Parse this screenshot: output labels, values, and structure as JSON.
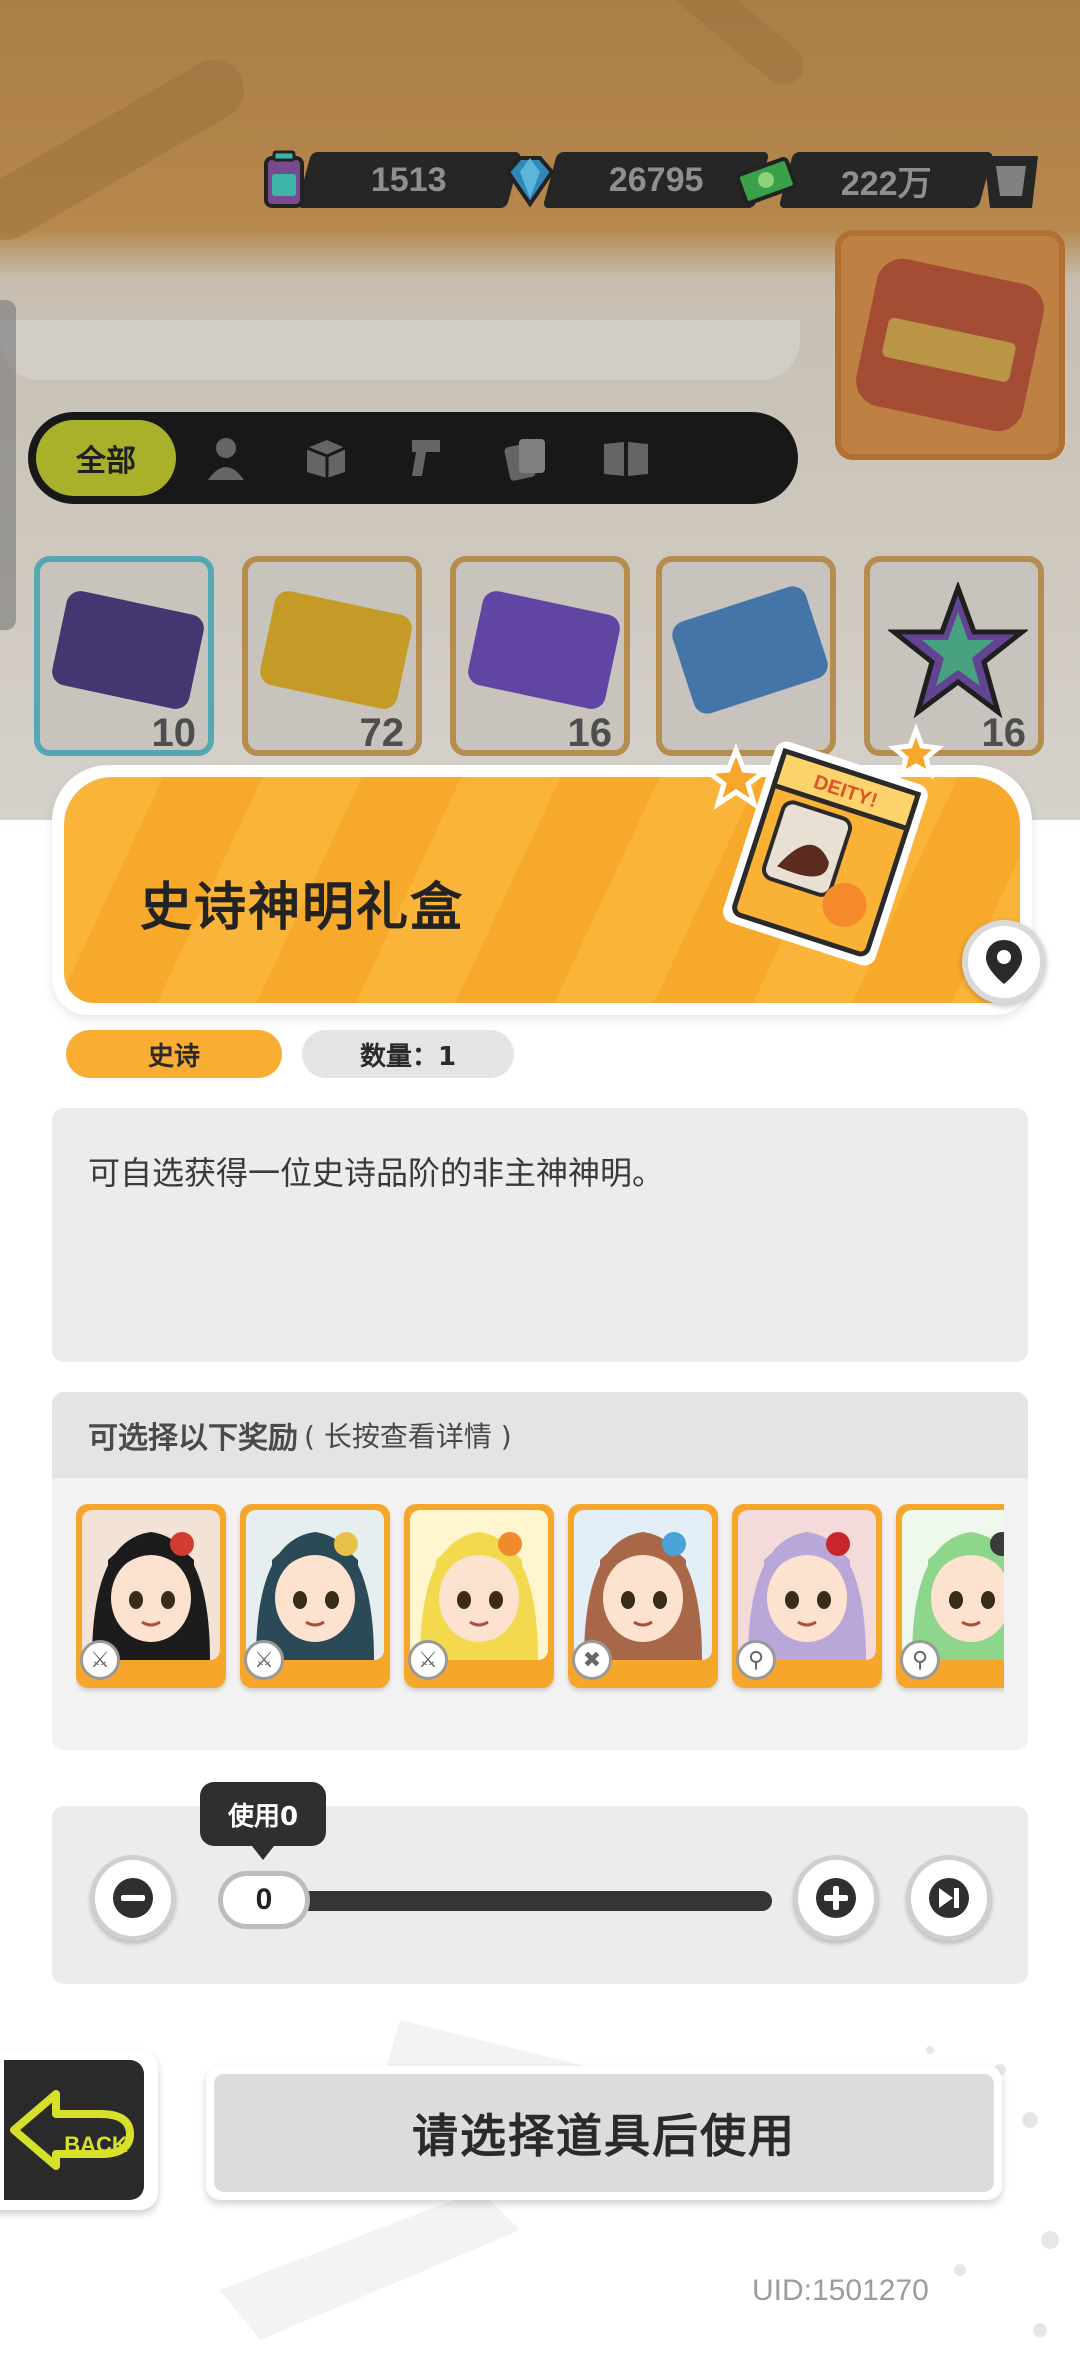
{
  "currencies": [
    {
      "icon": "battery-icon",
      "value": "1513"
    },
    {
      "icon": "diamond-icon",
      "value": "26795"
    },
    {
      "icon": "cash-icon",
      "value": "222万"
    }
  ],
  "tabs": {
    "all_label": "全部",
    "icons": [
      "person-icon",
      "box-icon",
      "gun-icon",
      "cards-icon",
      "book-icon"
    ]
  },
  "background_items": [
    {
      "count": "10"
    },
    {
      "count": "72"
    },
    {
      "count": "16"
    },
    {
      "count": ""
    },
    {
      "count": "16"
    }
  ],
  "item": {
    "title": "史诗神明礼盒",
    "rarity": "史诗",
    "quantity": "数量：1",
    "description": "可自选获得一位史诗品阶的非主神神明。",
    "box_label": "DEITY!"
  },
  "rewards": {
    "title": "可选择以下奖励",
    "hint": "( 长按查看详情 )",
    "characters": [
      {
        "icon": "sword-icon",
        "hair": "#1c1c1c",
        "accent": "#d23b2f",
        "bg": "#f3e3d6"
      },
      {
        "icon": "sword-icon",
        "hair": "#2b4a57",
        "accent": "#e8c04a",
        "bg": "#e7eef0"
      },
      {
        "icon": "sword-icon",
        "hair": "#f2d94d",
        "accent": "#f08a2c",
        "bg": "#fff6cf"
      },
      {
        "icon": "gun-icon",
        "hair": "#a86749",
        "accent": "#4aa3d8",
        "bg": "#e4eef7"
      },
      {
        "icon": "magnifier-icon",
        "hair": "#b8a7d8",
        "accent": "#c8262c",
        "bg": "#f5dada"
      },
      {
        "icon": "magnifier-icon",
        "hair": "#8fd68d",
        "accent": "#3b3b3b",
        "bg": "#eef8ec"
      }
    ]
  },
  "slider": {
    "tooltip": "使用0",
    "value": "0",
    "minus_icon": "minus-icon",
    "plus_icon": "plus-icon",
    "max_icon": "skip-to-end-icon"
  },
  "footer": {
    "back_label": "BACK",
    "use_button": "请选择道具后使用",
    "uid": "UID:1501270"
  },
  "colors": {
    "accent_orange": "#f9ad32",
    "dark": "#2a2a2a",
    "panel": "#ececec"
  }
}
